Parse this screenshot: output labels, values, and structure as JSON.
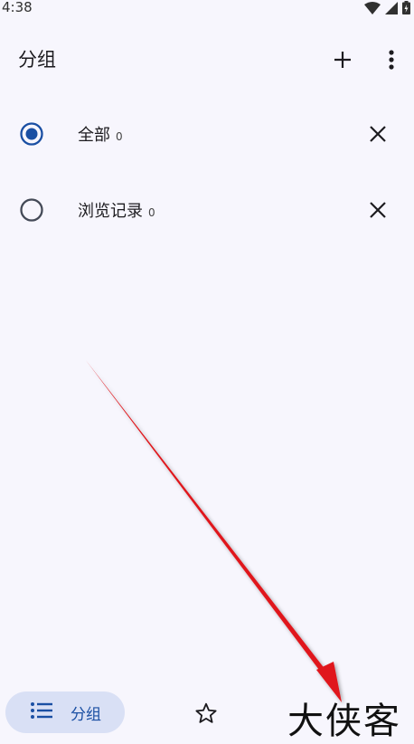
{
  "status": {
    "time": "4:38"
  },
  "appbar": {
    "title": "分组"
  },
  "groups": [
    {
      "label": "全部",
      "count": "0",
      "selected": true
    },
    {
      "label": "浏览记录",
      "count": "0",
      "selected": false
    }
  ],
  "bottomnav": {
    "groups_label": "分组"
  },
  "watermark": "大侠客",
  "colors": {
    "accent": "#1a4fa3",
    "background": "#f7f6fd",
    "nav_pill": "#d9e0f5",
    "arrow": "#e0141a"
  }
}
